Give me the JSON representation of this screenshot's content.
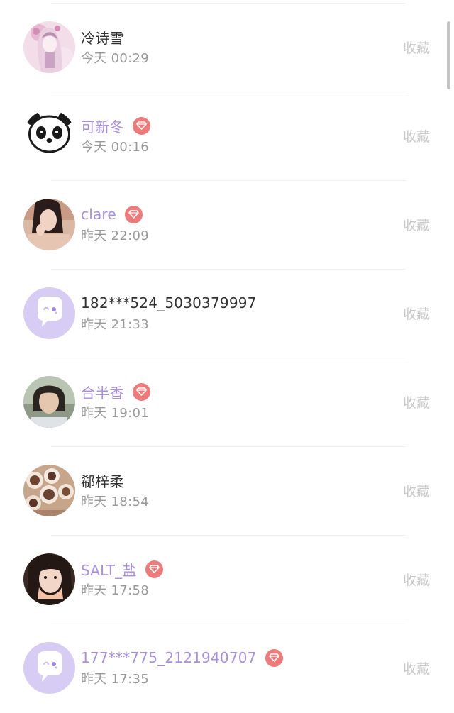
{
  "colors": {
    "vip_name": "#a98ee0",
    "normal_name": "#333333",
    "time": "#9a9a9a",
    "favorite": "#c9c9c9",
    "vip_badge": "#ee7b7b",
    "default_avatar_bg": "#d7ccf4"
  },
  "list": {
    "items": [
      {
        "name": "冷诗雪",
        "time": "今天 00:29",
        "vip": false,
        "avatar": "girl-illustration-avatar",
        "action": "收藏"
      },
      {
        "name": "可新冬",
        "time": "今天 00:16",
        "vip": true,
        "avatar": "panda-avatar",
        "action": "收藏"
      },
      {
        "name": "clare",
        "time": "昨天 22:09",
        "vip": true,
        "avatar": "photo-avatar",
        "action": "收藏"
      },
      {
        "name": "182***524_5030379997",
        "time": "昨天 21:33",
        "vip": false,
        "avatar": "default-chat-bubble-avatar",
        "action": "收藏"
      },
      {
        "name": "合半香",
        "time": "昨天 19:01",
        "vip": true,
        "avatar": "photo-avatar",
        "action": "收藏"
      },
      {
        "name": "郗梓柔",
        "time": "昨天 18:54",
        "vip": false,
        "avatar": "food-photo-avatar",
        "action": "收藏"
      },
      {
        "name": "SALT_盐",
        "time": "昨天 17:58",
        "vip": true,
        "avatar": "photo-avatar",
        "action": "收藏"
      },
      {
        "name": "177***775_2121940707",
        "time": "昨天 17:35",
        "vip": true,
        "avatar": "default-chat-bubble-avatar",
        "action": "收藏"
      }
    ]
  }
}
